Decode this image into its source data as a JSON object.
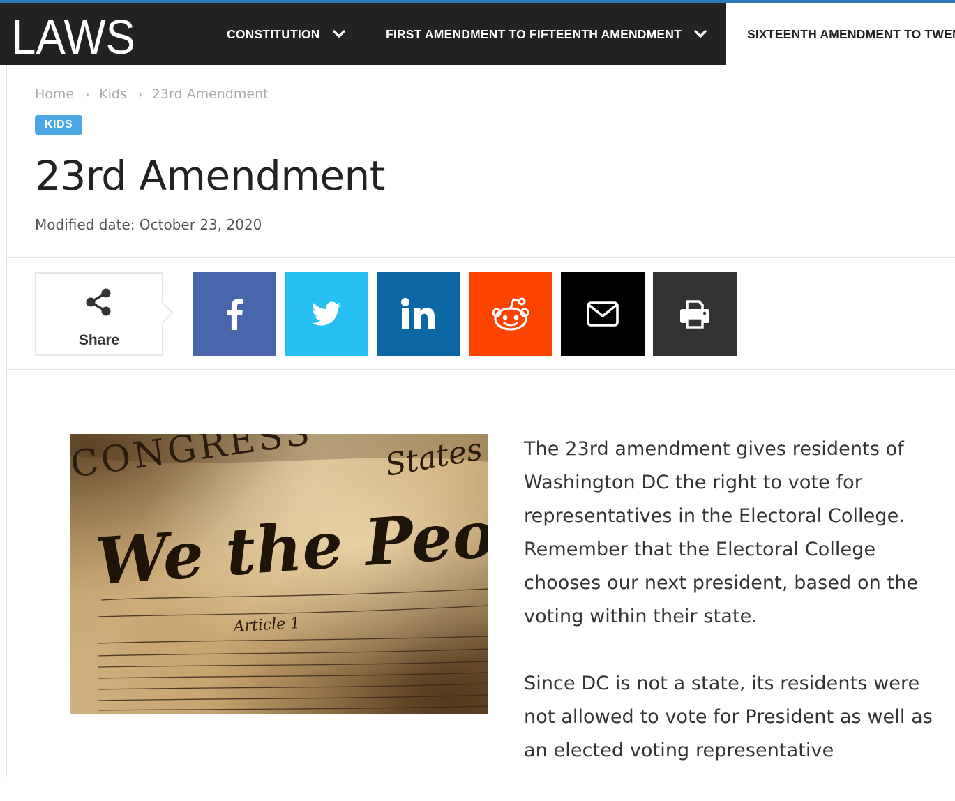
{
  "header": {
    "logo_text": "LAWS",
    "nav": [
      {
        "label": "CONSTITUTION"
      },
      {
        "label": "FIRST AMENDMENT TO FIFTEENTH AMENDMENT"
      },
      {
        "label": "SIXTEENTH AMENDMENT TO TWENTY-SEVENTH AMENDMENT"
      }
    ]
  },
  "breadcrumb": {
    "items": [
      "Home",
      "Kids",
      "23rd Amendment"
    ]
  },
  "category_badge": "KIDS",
  "article": {
    "title": "23rd Amendment",
    "modified": "Modified date: October 23, 2020",
    "paragraphs": [
      "The 23rd amendment gives residents of Washington DC the right to vote for representatives in the Electoral College. Remember that the Electoral College chooses our next president, based on the voting within their state.",
      "Since DC is not a state, its residents were not allowed to vote for President as well as an elected voting representative"
    ]
  },
  "share": {
    "label": "Share",
    "buttons": [
      {
        "name": "facebook",
        "icon": "facebook-icon",
        "color": "#4a66ab"
      },
      {
        "name": "twitter",
        "icon": "twitter-icon",
        "color": "#26c0f2"
      },
      {
        "name": "linkedin",
        "icon": "linkedin-icon",
        "color": "#0e67a5"
      },
      {
        "name": "reddit",
        "icon": "reddit-icon",
        "color": "#fa4400"
      },
      {
        "name": "email",
        "icon": "envelope-icon",
        "color": "#000000"
      },
      {
        "name": "print",
        "icon": "printer-icon",
        "color": "#333333"
      }
    ]
  },
  "image": {
    "text": [
      "CONGRESS",
      "States",
      "We the People",
      "Article 1"
    ]
  },
  "colors": {
    "topline": "#2f78b5",
    "navbar": "#222222",
    "badge": "#4aa8e6"
  }
}
